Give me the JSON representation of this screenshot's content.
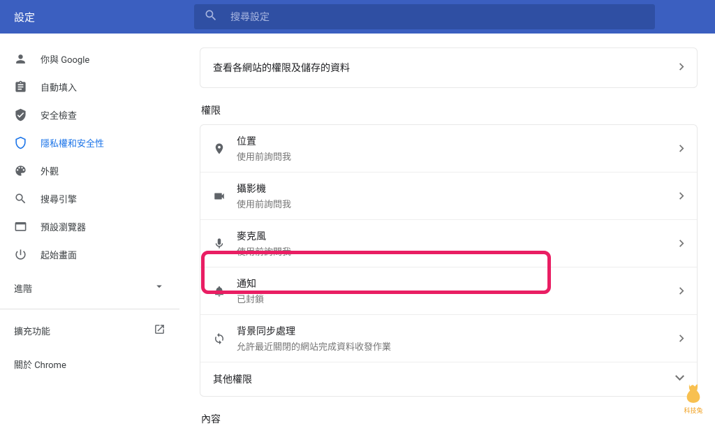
{
  "header": {
    "title": "設定",
    "search_placeholder": "搜尋設定"
  },
  "sidebar": {
    "items": [
      {
        "id": "you-google",
        "label": "你與 Google",
        "icon": "person"
      },
      {
        "id": "autofill",
        "label": "自動填入",
        "icon": "autofill"
      },
      {
        "id": "safety",
        "label": "安全檢查",
        "icon": "shield-check"
      },
      {
        "id": "privacy",
        "label": "隱私權和安全性",
        "icon": "shield"
      },
      {
        "id": "appearance",
        "label": "外觀",
        "icon": "palette"
      },
      {
        "id": "search-engine",
        "label": "搜尋引擎",
        "icon": "search"
      },
      {
        "id": "default-browser",
        "label": "預設瀏覽器",
        "icon": "browser"
      },
      {
        "id": "startup",
        "label": "起始畫面",
        "icon": "power"
      }
    ],
    "advanced": "進階",
    "extensions": "擴充功能",
    "about": "關於 Chrome"
  },
  "content": {
    "view_all_row": "查看各網站的權限及儲存的資料",
    "permissions_heading": "權限",
    "permissions": [
      {
        "id": "location",
        "title": "位置",
        "subtitle": "使用前詢問我",
        "icon": "pin"
      },
      {
        "id": "camera",
        "title": "攝影機",
        "subtitle": "使用前詢問我",
        "icon": "camera"
      },
      {
        "id": "mic",
        "title": "麥克風",
        "subtitle": "使用前詢問我",
        "icon": "mic"
      },
      {
        "id": "notifications",
        "title": "通知",
        "subtitle": "已封鎖",
        "icon": "bell"
      },
      {
        "id": "background-sync",
        "title": "背景同步處理",
        "subtitle": "允許最近關閉的網站完成資料收發作業",
        "icon": "sync"
      }
    ],
    "other_permissions": "其他權限",
    "content_heading": "內容"
  },
  "corner_logo_text": "科技兔"
}
